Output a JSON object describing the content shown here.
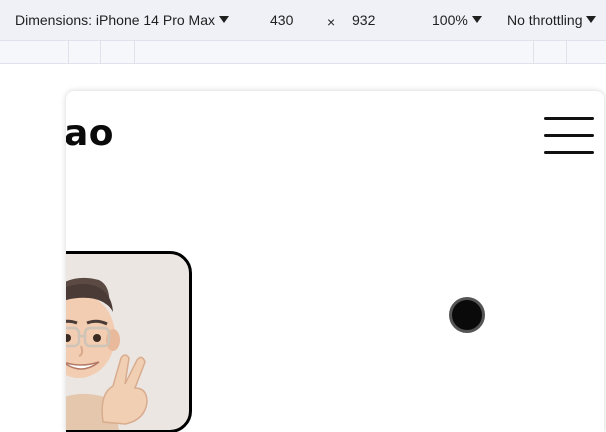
{
  "devtools": {
    "dimensions_label": "Dimensions: iPhone 14 Pro Max",
    "width": "430",
    "times": "×",
    "height": "932",
    "zoom": "100%",
    "throttling": "No throttling"
  },
  "site": {
    "brand_fragment": "ao"
  },
  "icons": {
    "caret": "caret-down-icon",
    "menu": "hamburger-menu-icon",
    "avatar": "memoji-avatar",
    "dot": "cursor-dot"
  },
  "colors": {
    "toolbar_bg": "#eff1f6",
    "avatar_bg": "#ebe6e2",
    "ink": "#0a0a0a"
  }
}
